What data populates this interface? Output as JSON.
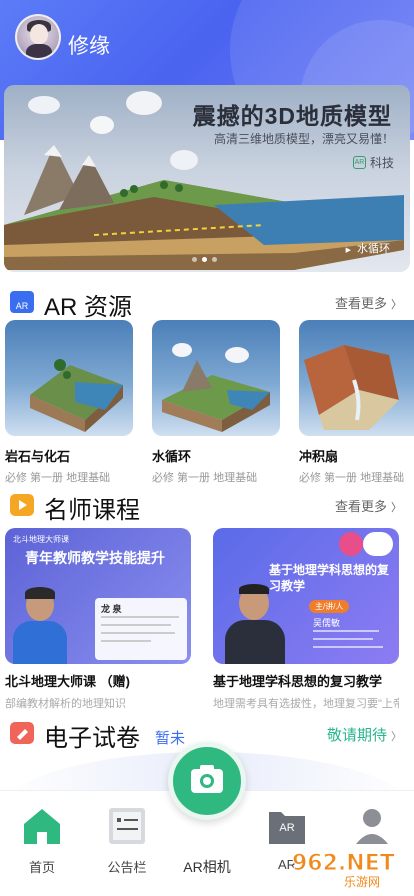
{
  "header": {
    "username": "修缘"
  },
  "banner": {
    "title": "震撼的3D地质模型",
    "subtitle": "高清三维地质模型，漂亮又易懂！",
    "brand": "科技",
    "brand_badge": "AR",
    "caption": "水循环"
  },
  "ar_section": {
    "title": "AR 资源",
    "icon_text": "AR",
    "more": "查看更多",
    "items": [
      {
        "name": "岩石与化石",
        "tag": "必修 第一册 地理基础"
      },
      {
        "name": "水循环",
        "tag": "必修 第一册 地理基础"
      },
      {
        "name": "冲积扇",
        "tag": "必修 第一册 地理基础"
      }
    ]
  },
  "course_section": {
    "title": "名师课程",
    "more": "查看更多",
    "items": [
      {
        "name": "北斗地理大师课 （赠)",
        "desc": "部编教材解析的地理知识",
        "thumb_top": "北斗地理大师课",
        "thumb_title": "青年教师教学技能提升",
        "thumb_teacher": "龙 泉"
      },
      {
        "name": "基于地理学科思想的复习教学",
        "desc": "地理需考具有选拔性，地理复习要\"上帝视角\"",
        "thumb_title": "基于地理学科思想的复习教学",
        "thumb_role": "主/讲/人",
        "thumb_teacher": "吴儒敏"
      }
    ]
  },
  "exam_section": {
    "title": "电子试卷",
    "subtitle": "暂未",
    "right": "敬请期待"
  },
  "nav": {
    "home": "首页",
    "notice": "公告栏",
    "camera": "AR相机",
    "ar": "AR",
    "ar_icon": "AR",
    "profile": ""
  },
  "colors": {
    "header": "#4f6cf2",
    "accent_green": "#2fb87f",
    "accent_blue": "#3b6df0"
  },
  "watermark": {
    "text": "962.NET",
    "sub": "乐游网"
  }
}
